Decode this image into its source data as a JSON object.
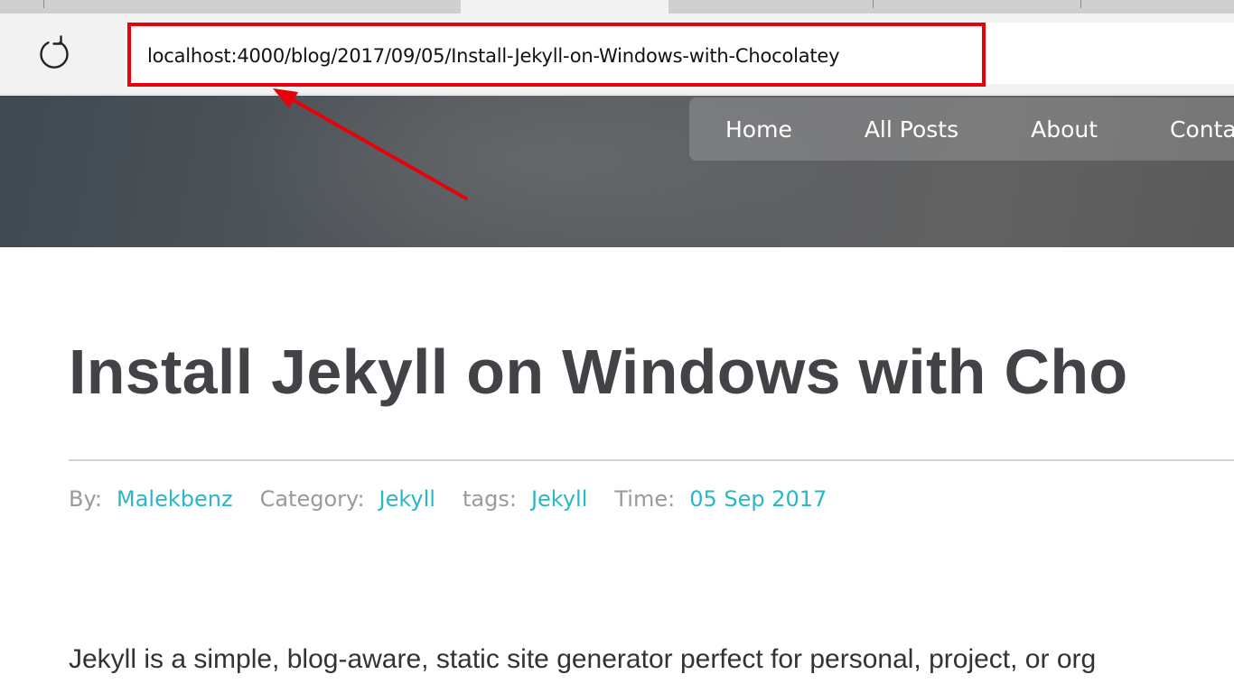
{
  "browser": {
    "address_url": "localhost:4000/blog/2017/09/05/Install-Jekyll-on-Windows-with-Chocolatey",
    "refresh_icon": "refresh-icon",
    "highlight_color": "#e8000b"
  },
  "site": {
    "nav": {
      "home": "Home",
      "all_posts": "All Posts",
      "about": "About",
      "contact": "Conta"
    }
  },
  "post": {
    "title": "Install Jekyll on Windows with Cho",
    "meta": {
      "by_label": "By:",
      "author": "Malekbenz",
      "category_label": "Category:",
      "category": "Jekyll",
      "tags_label": "tags:",
      "tag": "Jekyll",
      "time_label": "Time:",
      "date": "05 Sep 2017"
    },
    "intro": "Jekyll is a simple, blog-aware, static site generator perfect for personal, project, or org",
    "link_color": "#2bb6c8"
  }
}
